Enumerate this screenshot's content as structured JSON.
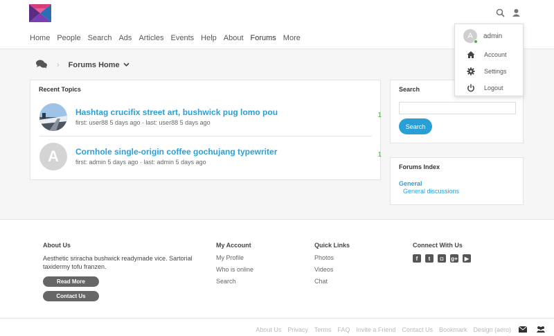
{
  "nav": [
    "Home",
    "People",
    "Search",
    "Ads",
    "Articles",
    "Events",
    "Help",
    "About",
    "Forums",
    "More"
  ],
  "dropdown": {
    "avatar_letter": "A",
    "username": "admin",
    "items": [
      "Account",
      "Settings",
      "Logout"
    ]
  },
  "breadcrumb": {
    "label": "Forums Home"
  },
  "recent": {
    "title": "Recent Topics",
    "topics": [
      {
        "title": "Hashtag crucifix street art, bushwick pug lomo pou",
        "meta": "first: user88 5 days ago · last: user88 5 days ago",
        "count": "1"
      },
      {
        "avatar_letter": "A",
        "title": "Cornhole single-origin coffee gochujang typewriter",
        "meta": "first: admin 5 days ago · last: admin 5 days ago",
        "count": "1"
      }
    ]
  },
  "search": {
    "title": "Search",
    "button": "Search"
  },
  "forums_index": {
    "title": "Forums Index",
    "category": "General",
    "subforum": "General discussions"
  },
  "footer": {
    "about": {
      "title": "About Us",
      "text": "Aesthetic sriracha bushwick readymade vice. Sartorial taxidermy tofu franzen.",
      "btn1": "Read More",
      "btn2": "Contact Us"
    },
    "account": {
      "title": "My Account",
      "links": [
        "My Profile",
        "Who is online",
        "Search"
      ]
    },
    "quick": {
      "title": "Quick Links",
      "links": [
        "Photos",
        "Videos",
        "Chat"
      ]
    },
    "connect": {
      "title": "Connect With Us",
      "icons": [
        "facebook-icon",
        "twitter-icon",
        "instagram-icon",
        "google-plus-icon",
        "youtube-icon"
      ]
    }
  },
  "bottom_links": [
    "About Us",
    "Privacy",
    "Terms",
    "FAQ",
    "Invite a Friend",
    "Contact Us",
    "Bookmark",
    "Design (aero)"
  ],
  "colors": {
    "accent": "#2a9fd6",
    "count": "#4cae4c"
  }
}
